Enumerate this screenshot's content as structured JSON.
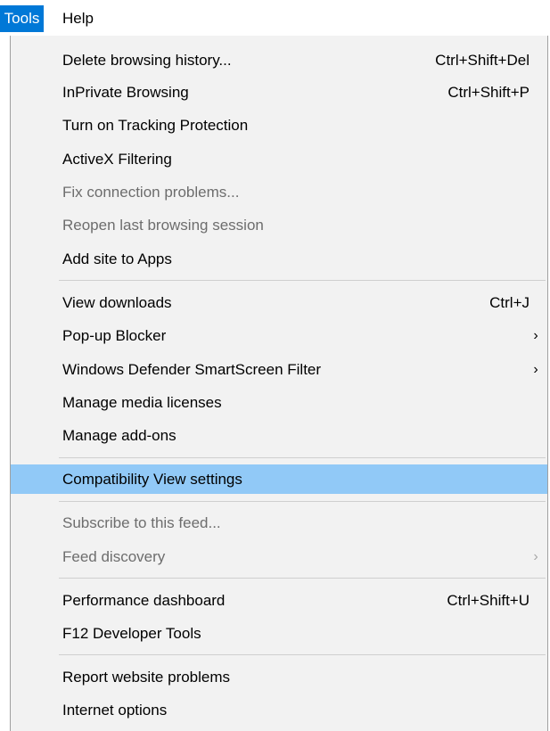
{
  "menubar": {
    "tools": "Tools",
    "help": "Help"
  },
  "menu": {
    "items": [
      {
        "label": "Delete browsing history...",
        "shortcut": "Ctrl+Shift+Del"
      },
      {
        "label": "InPrivate Browsing",
        "shortcut": "Ctrl+Shift+P"
      },
      {
        "label": "Turn on Tracking Protection",
        "shortcut": ""
      },
      {
        "label": "ActiveX Filtering",
        "shortcut": ""
      },
      {
        "label": "Fix connection problems...",
        "shortcut": "",
        "disabled": true
      },
      {
        "label": "Reopen last browsing session",
        "shortcut": "",
        "disabled": true
      },
      {
        "label": "Add site to Apps",
        "shortcut": ""
      },
      {
        "label": "View downloads",
        "shortcut": "Ctrl+J"
      },
      {
        "label": "Pop-up Blocker",
        "shortcut": "",
        "submenu": true,
        "arrow": "›"
      },
      {
        "label": "Windows Defender SmartScreen Filter",
        "shortcut": "",
        "submenu": true,
        "arrow": "›"
      },
      {
        "label": "Manage media licenses",
        "shortcut": ""
      },
      {
        "label": "Manage add-ons",
        "shortcut": ""
      },
      {
        "label": "Compatibility View settings",
        "shortcut": "",
        "highlighted": true
      },
      {
        "label": "Subscribe to this feed...",
        "shortcut": "",
        "disabled": true
      },
      {
        "label": "Feed discovery",
        "shortcut": "",
        "disabled": true,
        "submenu": true,
        "arrow": "›"
      },
      {
        "label": "Performance dashboard",
        "shortcut": "Ctrl+Shift+U"
      },
      {
        "label": "F12 Developer Tools",
        "shortcut": ""
      },
      {
        "label": "Report website problems",
        "shortcut": ""
      },
      {
        "label": "Internet options",
        "shortcut": ""
      }
    ]
  },
  "colors": {
    "tools_active_bg": "#0078d7",
    "menu_bg": "#f2f2f2",
    "highlight_bg": "#91c9f7",
    "disabled_text": "#6d6d6d"
  }
}
